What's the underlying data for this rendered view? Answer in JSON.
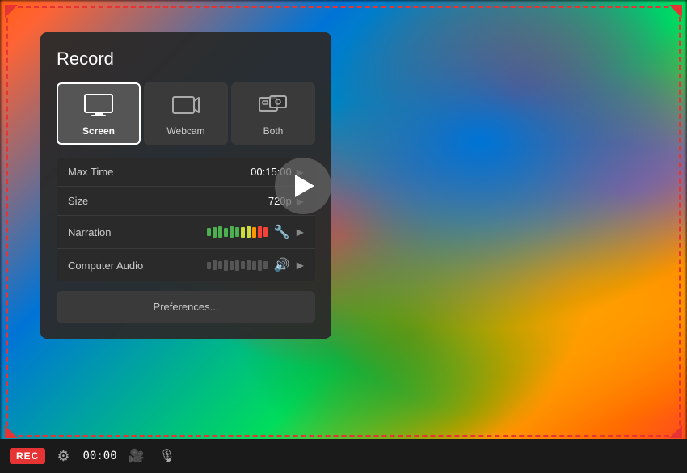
{
  "panel": {
    "title": "Record",
    "sources": [
      {
        "id": "screen",
        "label": "Screen",
        "icon": "🖥",
        "active": true
      },
      {
        "id": "webcam",
        "label": "Webcam",
        "icon": "📷",
        "active": false
      },
      {
        "id": "both",
        "label": "Both",
        "icon": "🎥",
        "active": false
      }
    ],
    "settings": [
      {
        "label": "Max Time",
        "value": "00:15:00",
        "type": "text"
      },
      {
        "label": "Size",
        "value": "720p",
        "type": "text"
      },
      {
        "label": "Narration",
        "value": "",
        "type": "audio-bars"
      },
      {
        "label": "Computer Audio",
        "value": "",
        "type": "speaker-bars"
      }
    ],
    "preferences_label": "Preferences..."
  },
  "bottom_bar": {
    "rec_label": "REC",
    "timer": "00:00"
  },
  "colors": {
    "accent_red": "#e63333",
    "panel_bg": "#2a2a2a",
    "text_light": "#ffffff",
    "text_muted": "#cccccc"
  }
}
